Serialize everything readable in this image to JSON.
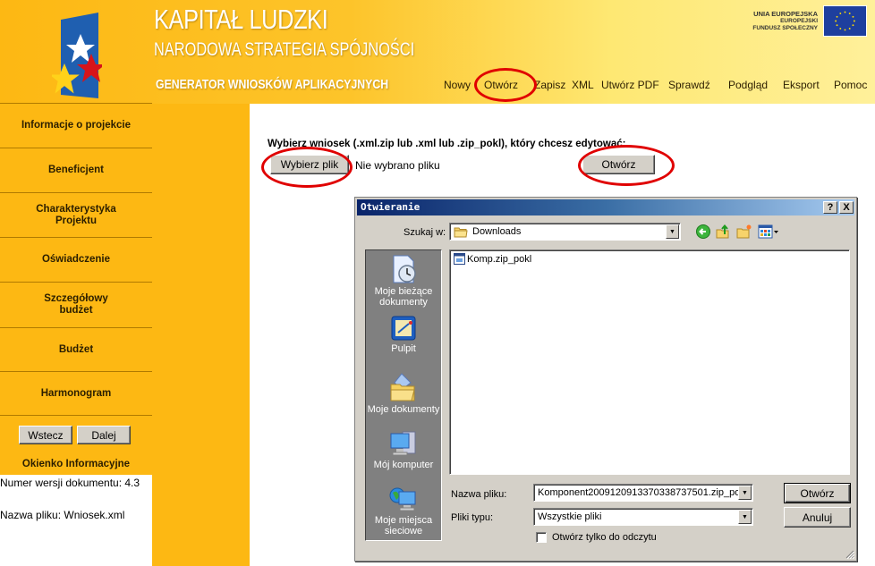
{
  "header": {
    "title_main": "KAPITAŁ LUDZKI",
    "title_sub": "NARODOWA STRATEGIA SPÓJNOŚCI",
    "title_gen": "GENERATOR WNIOSKÓW APLIKACYJNYCH",
    "eu_line1": "UNIA EUROPEJSKA",
    "eu_line2": "EUROPEJSKI",
    "eu_line3": "FUNDUSZ SPOŁECZNY",
    "nav": [
      "Nowy",
      "Otwórz",
      "Zapisz  XML",
      "Utwórz PDF",
      "Sprawdź",
      "Podgląd",
      "Eksport",
      "Pomoc"
    ]
  },
  "sidebar": {
    "items": [
      {
        "label": "Informacje o projekcie"
      },
      {
        "label": "Beneficjent"
      },
      {
        "label": "Charakterystyka Projektu"
      },
      {
        "label": "Oświadczenie"
      },
      {
        "label": "Szczegółowy budżet"
      },
      {
        "label": "Budżet"
      },
      {
        "label": "Harmonogram"
      }
    ],
    "back_label": "Wstecz",
    "next_label": "Dalej",
    "info_title": "Okienko Informacyjne",
    "info_version": "Numer wersji dokumentu: 4.3",
    "info_filename": "Nazwa pliku: Wniosek.xml"
  },
  "main": {
    "instruction": "Wybierz wniosek (.xml.zip lub .xml lub .zip_pokl), który chcesz edytować:",
    "choose_file_label": "Wybierz plik",
    "file_status": "Nie wybrano pliku",
    "open_label": "Otwórz"
  },
  "dialog": {
    "title": "Otwieranie",
    "help_label": "?",
    "close_label": "X",
    "look_in_label": "Szukaj w:",
    "look_in_value": "Downloads",
    "places": [
      {
        "label": "Moje bieżące dokumenty"
      },
      {
        "label": "Pulpit"
      },
      {
        "label": "Moje dokumenty"
      },
      {
        "label": "Mój komputer"
      },
      {
        "label": "Moje miejsca sieciowe"
      }
    ],
    "files": [
      {
        "name": "Komp.zip_pokl"
      }
    ],
    "filename_label": "Nazwa pliku:",
    "filename_value": "Komponent2009120913370338737501.zip_po",
    "filetype_label": "Pliki typu:",
    "filetype_value": "Wszystkie pliki",
    "readonly_label": "Otwórz tylko do odczytu",
    "readonly_checked": false,
    "open_label": "Otwórz",
    "cancel_label": "Anuluj"
  },
  "colors": {
    "brand_yellow": "#fdb813",
    "annotation_red": "#e00000",
    "dialog_title_blue": "#0a246a"
  }
}
